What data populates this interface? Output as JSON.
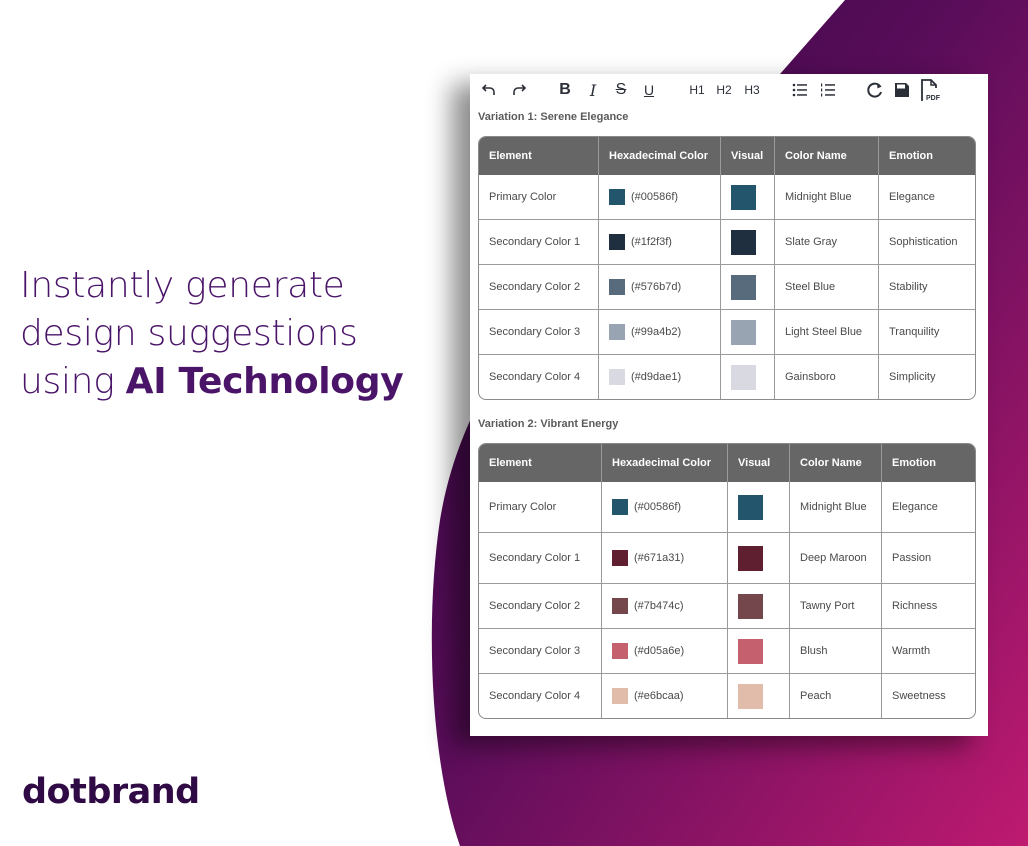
{
  "brand": {
    "logo_text": "dotbrand",
    "headline_line1": "Instantly generate",
    "headline_line2": "design suggestions",
    "headline_line3_plain": "using ",
    "headline_line3_bold": "AI Technology",
    "colors": {
      "text": "#4a1468",
      "logo": "#2f0a45",
      "gradient_start": "#3a0a4a",
      "gradient_end": "#b81a6e"
    }
  },
  "toolbar": {
    "undo": "undo-icon",
    "redo": "redo-icon",
    "bold_label": "B",
    "italic_label": "I",
    "strike_label": "S",
    "underline_label": "U",
    "h1_label": "H1",
    "h2_label": "H2",
    "h3_label": "H3",
    "bullet_list": "bullet-list-icon",
    "numbered_list": "numbered-list-icon",
    "refresh": "refresh-icon",
    "save": "save-icon",
    "pdf_label": "PDF"
  },
  "columns": [
    "Element",
    "Hexadecimal Color",
    "Visual",
    "Color Name",
    "Emotion"
  ],
  "variations": [
    {
      "title": "Variation 1: Serene Elegance",
      "rows": [
        {
          "element": "Primary Color",
          "hex": "(#00586f)",
          "swatch": "#23556c",
          "name": "Midnight Blue",
          "emotion": "Elegance"
        },
        {
          "element": "Secondary Color 1",
          "hex": "(#1f2f3f)",
          "swatch": "#1f2f3f",
          "name": "Slate Gray",
          "emotion": "Sophistication"
        },
        {
          "element": "Secondary Color 2",
          "hex": "(#576b7d)",
          "swatch": "#576b7d",
          "name": "Steel Blue",
          "emotion": "Stability"
        },
        {
          "element": "Secondary Color 3",
          "hex": "(#99a4b2)",
          "swatch": "#99a4b2",
          "name": "Light Steel Blue",
          "emotion": "Tranquility"
        },
        {
          "element": "Secondary Color 4",
          "hex": "(#d9dae1)",
          "swatch": "#d9dae1",
          "name": "Gainsboro",
          "emotion": "Simplicity"
        }
      ]
    },
    {
      "title": "Variation 2: Vibrant Energy",
      "rows": [
        {
          "element": "Primary Color",
          "hex": "(#00586f)",
          "swatch": "#23556c",
          "name": "Midnight Blue",
          "emotion": "Elegance"
        },
        {
          "element": "Secondary Color 1",
          "hex": "(#671a31)",
          "swatch": "#5f1f31",
          "name": "Deep Maroon",
          "emotion": "Passion"
        },
        {
          "element": "Secondary Color 2",
          "hex": "(#7b474c)",
          "swatch": "#73474c",
          "name": "Tawny Port",
          "emotion": "Richness"
        },
        {
          "element": "Secondary Color 3",
          "hex": "(#d05a6e)",
          "swatch": "#c5616e",
          "name": "Blush",
          "emotion": "Warmth"
        },
        {
          "element": "Secondary Color 4",
          "hex": "(#e6bcaa)",
          "swatch": "#e2bcaa",
          "name": "Peach",
          "emotion": "Sweetness"
        }
      ]
    }
  ]
}
